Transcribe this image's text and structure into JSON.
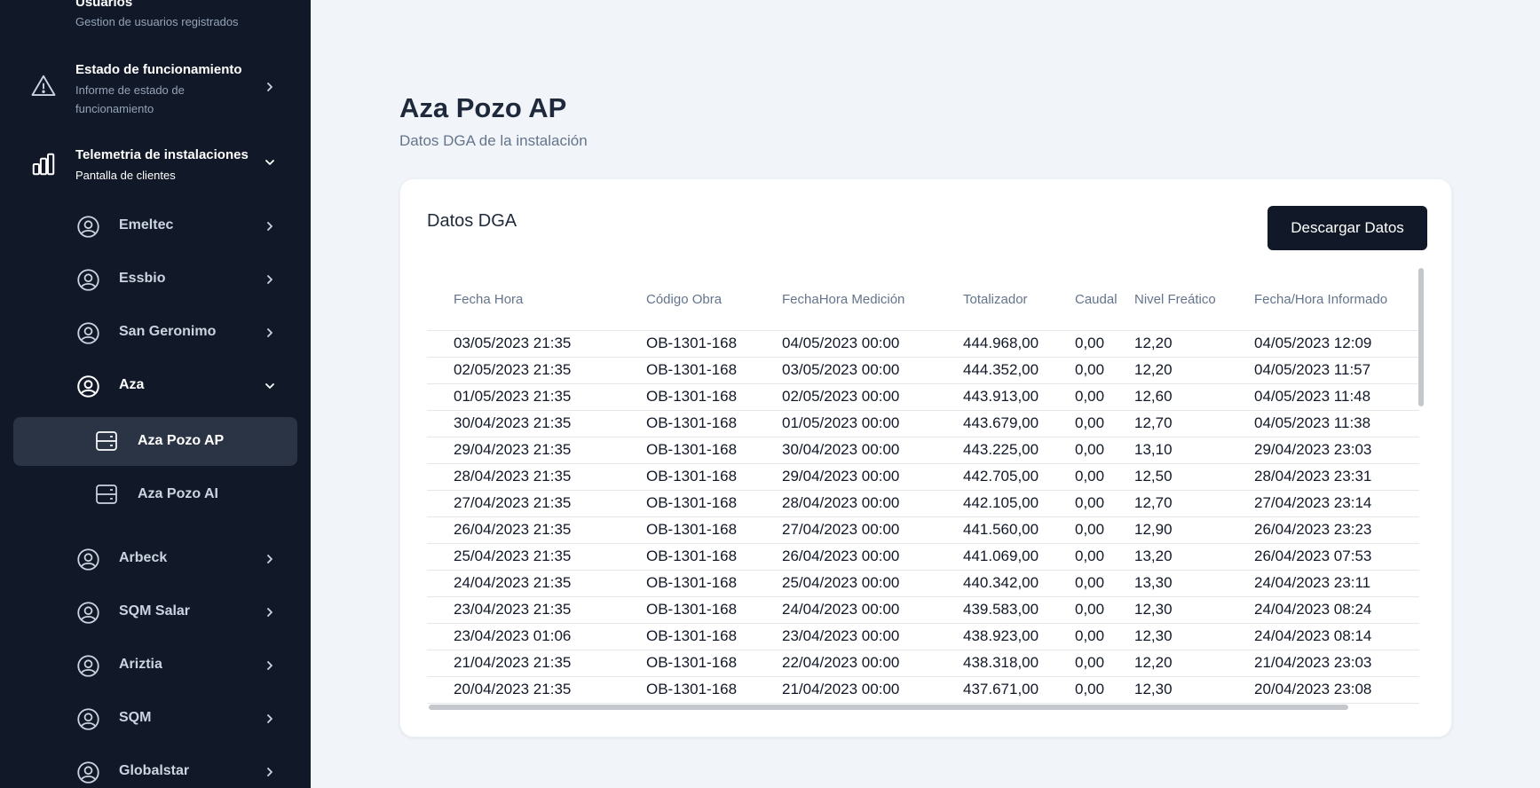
{
  "sidebar": {
    "usuarios": {
      "title": "Usuarios",
      "subtitle": "Gestion de usuarios registrados"
    },
    "estado": {
      "title": "Estado de funcionamiento",
      "subtitle": "Informe de estado de funcionamiento"
    },
    "telemetria": {
      "title": "Telemetria de instalaciones",
      "subtitle": "Pantalla de clientes"
    },
    "clients": {
      "emeltec": "Emeltec",
      "essbio": "Essbio",
      "san_geronimo": "San Geronimo",
      "aza": "Aza",
      "arbeck": "Arbeck",
      "sqm_salar": "SQM Salar",
      "ariztia": "Ariztia",
      "sqm": "SQM",
      "globalstar": "Globalstar"
    },
    "installations": {
      "aza_pozo_ap": "Aza Pozo AP",
      "aza_pozo_ai": "Aza Pozo AI"
    }
  },
  "page": {
    "title": "Aza Pozo AP",
    "subtitle": "Datos DGA de la instalación"
  },
  "card": {
    "title": "Datos DGA",
    "download_label": "Descargar Datos"
  },
  "table": {
    "headers": [
      "Fecha Hora",
      "Código Obra",
      "FechaHora Medición",
      "Totalizador",
      "Caudal",
      "Nivel Freático",
      "Fecha/Hora Informado"
    ],
    "rows": [
      [
        "03/05/2023 21:35",
        "OB-1301-168",
        "04/05/2023 00:00",
        "444.968,00",
        "0,00",
        "12,20",
        "04/05/2023 12:09"
      ],
      [
        "02/05/2023 21:35",
        "OB-1301-168",
        "03/05/2023 00:00",
        "444.352,00",
        "0,00",
        "12,20",
        "04/05/2023 11:57"
      ],
      [
        "01/05/2023 21:35",
        "OB-1301-168",
        "02/05/2023 00:00",
        "443.913,00",
        "0,00",
        "12,60",
        "04/05/2023 11:48"
      ],
      [
        "30/04/2023 21:35",
        "OB-1301-168",
        "01/05/2023 00:00",
        "443.679,00",
        "0,00",
        "12,70",
        "04/05/2023 11:38"
      ],
      [
        "29/04/2023 21:35",
        "OB-1301-168",
        "30/04/2023 00:00",
        "443.225,00",
        "0,00",
        "13,10",
        "29/04/2023 23:03"
      ],
      [
        "28/04/2023 21:35",
        "OB-1301-168",
        "29/04/2023 00:00",
        "442.705,00",
        "0,00",
        "12,50",
        "28/04/2023 23:31"
      ],
      [
        "27/04/2023 21:35",
        "OB-1301-168",
        "28/04/2023 00:00",
        "442.105,00",
        "0,00",
        "12,70",
        "27/04/2023 23:14"
      ],
      [
        "26/04/2023 21:35",
        "OB-1301-168",
        "27/04/2023 00:00",
        "441.560,00",
        "0,00",
        "12,90",
        "26/04/2023 23:23"
      ],
      [
        "25/04/2023 21:35",
        "OB-1301-168",
        "26/04/2023 00:00",
        "441.069,00",
        "0,00",
        "13,20",
        "26/04/2023 07:53"
      ],
      [
        "24/04/2023 21:35",
        "OB-1301-168",
        "25/04/2023 00:00",
        "440.342,00",
        "0,00",
        "13,30",
        "24/04/2023 23:11"
      ],
      [
        "23/04/2023 21:35",
        "OB-1301-168",
        "24/04/2023 00:00",
        "439.583,00",
        "0,00",
        "12,30",
        "24/04/2023 08:24"
      ],
      [
        "23/04/2023 01:06",
        "OB-1301-168",
        "23/04/2023 00:00",
        "438.923,00",
        "0,00",
        "12,30",
        "24/04/2023 08:14"
      ],
      [
        "21/04/2023 21:35",
        "OB-1301-168",
        "22/04/2023 00:00",
        "438.318,00",
        "0,00",
        "12,20",
        "21/04/2023 23:03"
      ],
      [
        "20/04/2023 21:35",
        "OB-1301-168",
        "21/04/2023 00:00",
        "437.671,00",
        "0,00",
        "12,30",
        "20/04/2023 23:08"
      ]
    ]
  }
}
